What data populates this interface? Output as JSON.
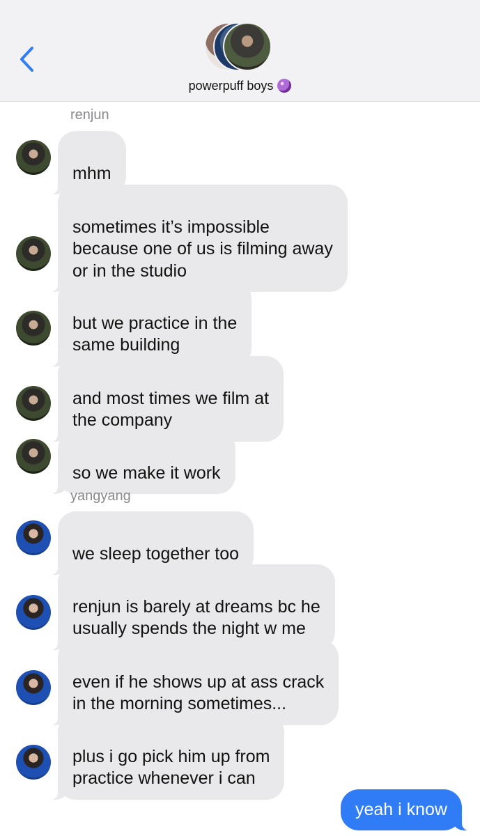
{
  "header": {
    "back_icon": "chevron-left-icon",
    "group_name": "powerpuff boys",
    "group_emoji": "crystal-ball-emoji",
    "accent_color": "#2F7CF6",
    "avatars": [
      "group-member-avatar",
      "group-member-avatar",
      "group-member-avatar"
    ]
  },
  "senders": {
    "renjun": "renjun",
    "yangyang": "yangyang"
  },
  "messages": [
    {
      "sender": "renjun",
      "text": "mhm"
    },
    {
      "sender": "renjun",
      "text": "sometimes it’s impossible\nbecause one of us is filming away\nor in the studio"
    },
    {
      "sender": "renjun",
      "text": "but we practice in the\nsame building"
    },
    {
      "sender": "renjun",
      "text": "and most times we film at\nthe company"
    },
    {
      "sender": "renjun",
      "text": "so we make it work"
    },
    {
      "sender": "yangyang",
      "text": "we sleep together too"
    },
    {
      "sender": "yangyang",
      "text": "renjun is barely at dreams bc he\nusually spends the night w me"
    },
    {
      "sender": "yangyang",
      "text": "even if he shows up at ass crack\nin the morning sometimes..."
    },
    {
      "sender": "yangyang",
      "text": "plus i go pick him up from\npractice whenever i can"
    }
  ],
  "outgoing": {
    "text": "yeah i know",
    "color": "#2F7CF6"
  },
  "incoming_bubble_color": "#E9E9EB"
}
